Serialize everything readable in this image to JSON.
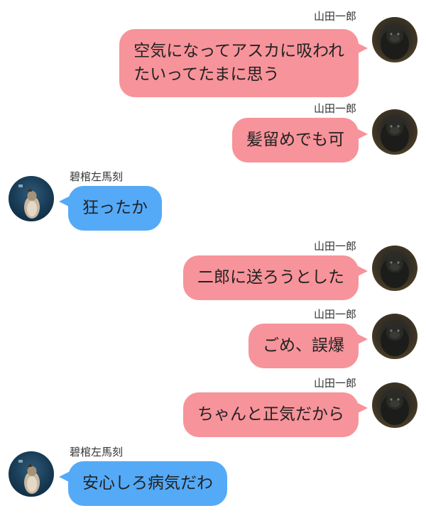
{
  "messages": [
    {
      "side": "right",
      "sender": "山田一郎",
      "text": "空気になってアスカに吸われ\nたいってたまに思う",
      "avatar_icon": "gorilla-avatar-icon"
    },
    {
      "side": "right",
      "sender": "山田一郎",
      "text": "髪留めでも可",
      "avatar_icon": "gorilla-avatar-icon"
    },
    {
      "side": "left",
      "sender": "碧棺左馬刻",
      "text": "狂ったか",
      "avatar_icon": "penguin-avatar-icon"
    },
    {
      "side": "right",
      "sender": "山田一郎",
      "text": "二郎に送ろうとした",
      "avatar_icon": "gorilla-avatar-icon"
    },
    {
      "side": "right",
      "sender": "山田一郎",
      "text": "ごめ、誤爆",
      "avatar_icon": "gorilla-avatar-icon"
    },
    {
      "side": "right",
      "sender": "山田一郎",
      "text": "ちゃんと正気だから",
      "avatar_icon": "gorilla-avatar-icon"
    },
    {
      "side": "left",
      "sender": "碧棺左馬刻",
      "text": "安心しろ病気だわ",
      "avatar_icon": "penguin-avatar-icon"
    }
  ],
  "colors": {
    "self_bubble": "#f7939a",
    "other_bubble": "#55aaf8",
    "background": "#ffffff"
  }
}
